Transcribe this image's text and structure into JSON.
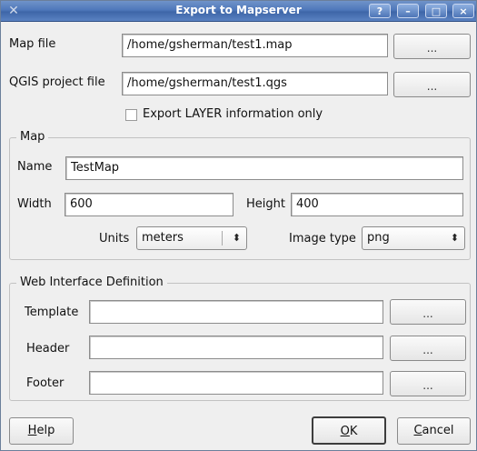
{
  "window": {
    "title": "Export to Mapserver",
    "controls": {
      "help": "?",
      "minimize": "–",
      "maximize": "□",
      "close": "×"
    }
  },
  "top": {
    "map_file_label": "Map file",
    "map_file_value": "/home/gsherman/test1.map",
    "qgis_project_label": "QGIS project file",
    "qgis_project_value": "/home/gsherman/test1.qgs",
    "browse_label": "...",
    "export_layer_label": "Export LAYER information only",
    "export_layer_checked": false
  },
  "map_group": {
    "title": "Map",
    "name_label": "Name",
    "name_value": "TestMap",
    "width_label": "Width",
    "width_value": "600",
    "height_label": "Height",
    "height_value": "400",
    "units_label": "Units",
    "units_value": "meters",
    "image_type_label": "Image type",
    "image_type_value": "png"
  },
  "web_group": {
    "title": "Web Interface Definition",
    "template_label": "Template",
    "template_value": "",
    "header_label": "Header",
    "header_value": "",
    "footer_label": "Footer",
    "footer_value": "",
    "browse_label": "..."
  },
  "buttons": {
    "help_mnemonic": "H",
    "help_rest": "elp",
    "ok_mnemonic": "O",
    "ok_rest": "K",
    "cancel_mnemonic": "C",
    "cancel_rest": "ancel"
  },
  "icons": {
    "window_icon": "x-logo-icon",
    "combo_arrow": "updown-arrow-icon"
  }
}
